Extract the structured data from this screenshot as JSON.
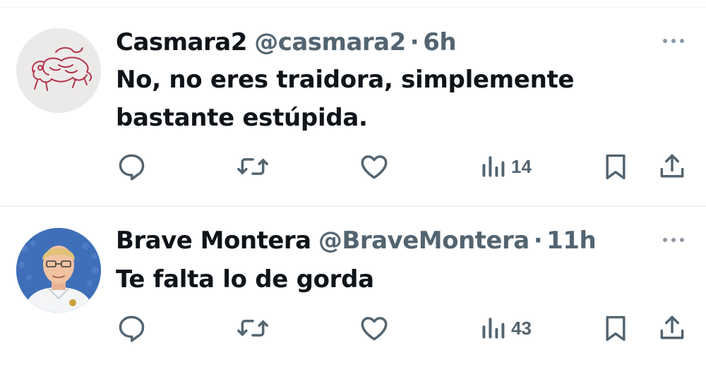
{
  "tweets": [
    {
      "name": "Casmara2",
      "handle": "@casmara2",
      "separator": "·",
      "time": "6h",
      "text": "No, no eres traidora, simplemente bastante estúpida.",
      "views": "14",
      "avatar_icon": "red-lion-sketch-avatar"
    },
    {
      "name": "Brave Montera",
      "handle": "@BraveMontera",
      "separator": "·",
      "time": "11h",
      "text": "Te falta lo de gorda",
      "views": "43",
      "avatar_icon": "person-photo-avatar"
    }
  ],
  "icons": {
    "reply": "reply-icon",
    "retweet": "retweet-icon",
    "like": "like-heart-icon",
    "views": "views-chart-icon",
    "bookmark": "bookmark-icon",
    "share": "share-icon",
    "more": "more-dots-icon"
  },
  "colors": {
    "text": "#0f1419",
    "secondary": "#536471",
    "divider": "#eff3f4"
  }
}
